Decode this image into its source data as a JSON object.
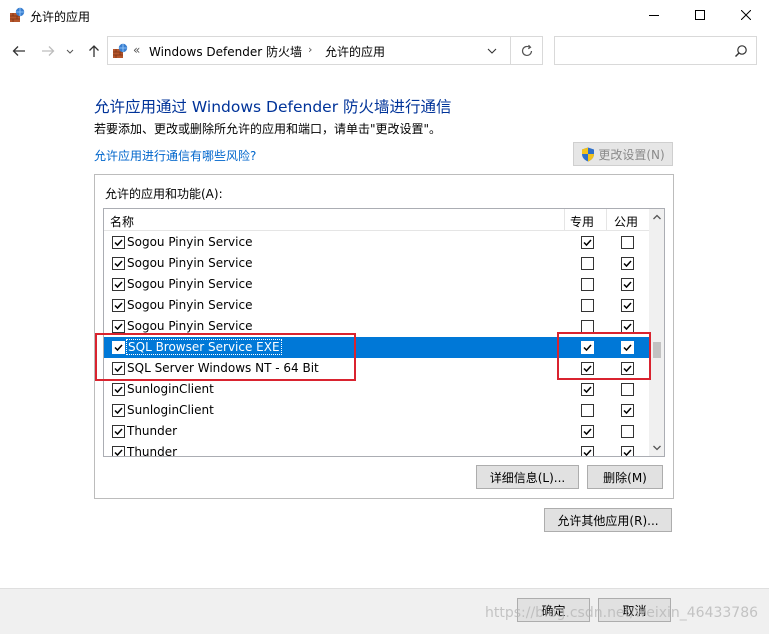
{
  "window": {
    "title": "允许的应用",
    "icon": "firewall-app-icon"
  },
  "nav": {
    "address_prefix": "«",
    "breadcrumb": [
      "Windows Defender 防火墙",
      "允许的应用"
    ],
    "search_placeholder": ""
  },
  "main": {
    "heading": "允许应用通过 Windows Defender 防火墙进行通信",
    "subtext": "若要添加、更改或删除所允许的应用和端口，请单击\"更改设置\"。",
    "risk_link": "允许应用进行通信有哪些风险?",
    "change_settings": "更改设置(N)",
    "group_label": "允许的应用和功能(A):",
    "columns": {
      "name": "名称",
      "private": "专用",
      "public": "公用"
    },
    "rows": [
      {
        "name": "Sogou Pinyin Service",
        "enabled": true,
        "private": true,
        "public": false,
        "selected": false
      },
      {
        "name": "Sogou Pinyin Service",
        "enabled": true,
        "private": false,
        "public": true,
        "selected": false
      },
      {
        "name": "Sogou Pinyin Service",
        "enabled": true,
        "private": false,
        "public": true,
        "selected": false
      },
      {
        "name": "Sogou Pinyin Service",
        "enabled": true,
        "private": false,
        "public": true,
        "selected": false
      },
      {
        "name": "Sogou Pinyin Service",
        "enabled": true,
        "private": false,
        "public": true,
        "selected": false
      },
      {
        "name": "SQL Browser Service EXE",
        "enabled": true,
        "private": true,
        "public": true,
        "selected": true
      },
      {
        "name": "SQL Server Windows NT - 64 Bit",
        "enabled": true,
        "private": true,
        "public": true,
        "selected": false
      },
      {
        "name": "SunloginClient",
        "enabled": true,
        "private": true,
        "public": false,
        "selected": false
      },
      {
        "name": "SunloginClient",
        "enabled": true,
        "private": false,
        "public": true,
        "selected": false
      },
      {
        "name": "Thunder",
        "enabled": true,
        "private": true,
        "public": false,
        "selected": false
      },
      {
        "name": "Thunder",
        "enabled": true,
        "private": true,
        "public": true,
        "selected": false
      }
    ],
    "details_button": "详细信息(L)...",
    "delete_button": "删除(M)",
    "allow_other_button": "允许其他应用(R)..."
  },
  "footer": {
    "ok_button": "确定",
    "cancel_button": "取消",
    "watermark": "https://blog.csdn.net/weixin_46433786"
  },
  "colors": {
    "heading": "#003399",
    "link": "#0066cc",
    "selection": "#0078d7",
    "highlight_box": "#d9232f"
  }
}
